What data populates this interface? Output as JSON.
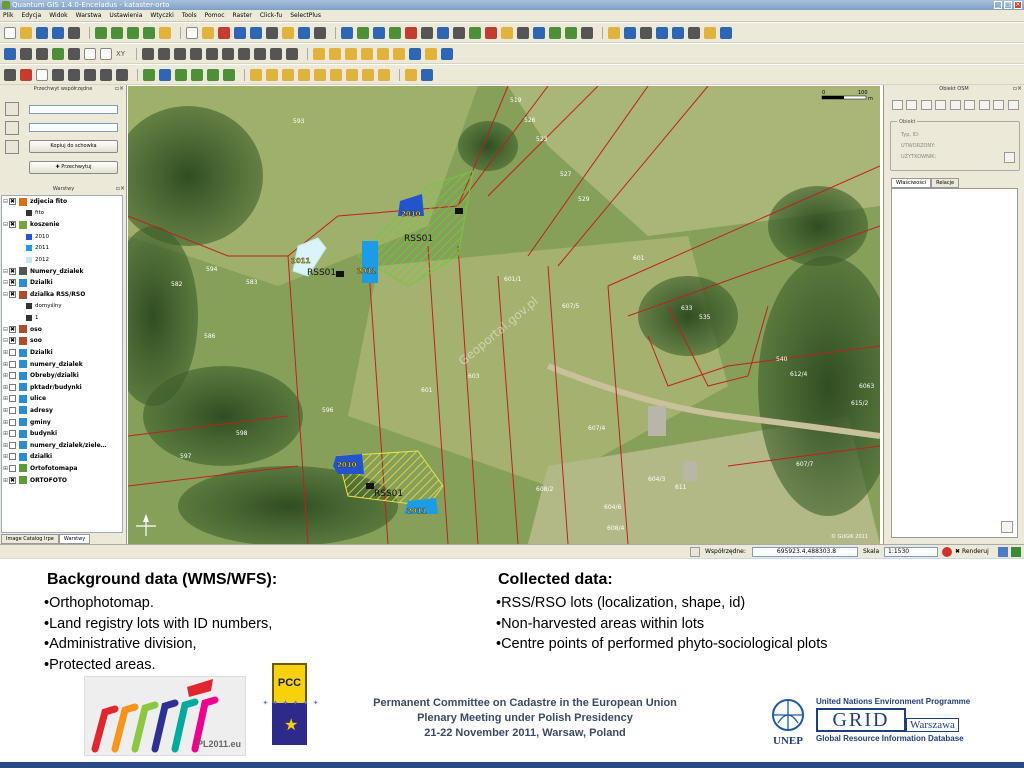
{
  "window": {
    "title": "Quantum GIS 1.4.0-Enceladus - kataster-orto"
  },
  "menu": [
    "Plik",
    "Edycja",
    "Widok",
    "Warstwa",
    "Ustawienia",
    "Wtyczki",
    "Tools",
    "Pomoc",
    "Raster",
    "Click-fu",
    "SelectPlus"
  ],
  "toolbar": {
    "xy_label": "XY"
  },
  "left_panel": {
    "coord_title": "Przechwyt współrzędne",
    "copy_button": "Kopiuj do schowka",
    "capture_button": "Przechwytuj",
    "layers_title": "Warstwy",
    "layers": [
      {
        "label": "zdjecia fito",
        "checked": true,
        "expanded": true
      },
      {
        "label": "fito",
        "sub": true
      },
      {
        "label": "koszenie",
        "checked": true,
        "expanded": true
      },
      {
        "label": "2010",
        "sub": true,
        "color": "#2255cc"
      },
      {
        "label": "2011",
        "sub": true,
        "color": "#1e9be6"
      },
      {
        "label": "2012",
        "sub": true,
        "color": "#bfe9f7"
      },
      {
        "label": "Numery_dzialek",
        "checked": true,
        "expanded": true
      },
      {
        "label": "Dzialki",
        "checked": true,
        "expanded": true
      },
      {
        "label": "dzialka RSS/RSO",
        "checked": true,
        "expanded": true
      },
      {
        "label": "domyślny",
        "sub": true
      },
      {
        "label": "1",
        "sub": true
      },
      {
        "label": "oso",
        "checked": true,
        "expanded": true
      },
      {
        "label": "soo",
        "checked": true,
        "expanded": true
      },
      {
        "label": "Dzialki",
        "checked": false
      },
      {
        "label": "numery_dzialek",
        "checked": false
      },
      {
        "label": "Obreby/dzialki",
        "checked": false
      },
      {
        "label": "pktadr/budynki",
        "checked": false
      },
      {
        "label": "ulice",
        "checked": false
      },
      {
        "label": "adresy",
        "checked": false
      },
      {
        "label": "gminy",
        "checked": false
      },
      {
        "label": "budynki",
        "checked": false
      },
      {
        "label": "numery_dzialek/ziele…",
        "checked": false
      },
      {
        "label": "dzialki",
        "checked": false
      },
      {
        "label": "Ortofotomapa",
        "checked": false
      },
      {
        "label": "ORTOFOTO",
        "checked": true
      }
    ],
    "tabs": [
      "Image Catalog Irpe",
      "Warstwy"
    ]
  },
  "right_panel": {
    "title": "Obiekt OSM",
    "object_group": "Obiekt",
    "fields": [
      "Typ, ID:",
      "UTWORZONY:",
      "UŻYTKOWNIK:"
    ],
    "tabs": [
      "Właściwości",
      "Relacje"
    ]
  },
  "map": {
    "plot_labels": [
      "519",
      "526",
      "523",
      "527",
      "529",
      "593",
      "594",
      "582",
      "583",
      "586",
      "601",
      "603",
      "607/4",
      "601/1",
      "607/5",
      "596",
      "598",
      "597",
      "608/2",
      "611",
      "633",
      "535",
      "540",
      "612/4",
      "615/2",
      "6063",
      "601",
      "604/3",
      "608/4",
      "604/6",
      "607/7"
    ],
    "area_labels": [
      "RSS01",
      "RSS01",
      "RSS01"
    ],
    "year_labels": [
      "2010",
      "2011",
      "2012",
      "2010",
      "2011"
    ],
    "watermark": "Geoportal.gov.pl",
    "scalebar": {
      "left": "0",
      "right": "100",
      "unit": "m"
    },
    "copyright": "© GUGiK 2011"
  },
  "status": {
    "coords_label": "Współrzędne:",
    "coords_value": "695923.4,488303.8",
    "scale_label": "Skala",
    "scale_value": "1:1530",
    "render_label": "Renderuj"
  },
  "slide": {
    "left_heading": "Background  data (WMS/WFS):",
    "left_bullets": [
      "Orthophotomap.",
      "Land registry lots with ID numbers,",
      "Administrative division,",
      "Protected areas."
    ],
    "right_heading": "Collected data:",
    "right_bullets": [
      "RSS/RSO  lots (localization, shape, id)",
      "Non-harvested areas within lots",
      "Centre points of performed  phyto-sociological plots"
    ],
    "footer": [
      "Permanent Committee on Cadastre in the European Union",
      "Plenary Meeting under Polish Presidency",
      "21-22 November 2011, Warsaw, Poland"
    ],
    "logos": {
      "pl_logo_text": "PL2011.eu",
      "pcc_text": "PCC",
      "unep_text": "UNEP",
      "grid_top": "United Nations Environment Programme",
      "grid_word": "GRID",
      "grid_city": "Warszawa",
      "grid_bottom": "Global Resource Information Database"
    }
  },
  "colors": {
    "ui_bg": "#ece9d8",
    "map_green": "#7f9a55",
    "lot_line": "#c02020",
    "year_2010": "#2255cc",
    "year_2011": "#1e9be6",
    "year_2012": "#bfe9f7",
    "hatch": "#6ccc3a"
  }
}
